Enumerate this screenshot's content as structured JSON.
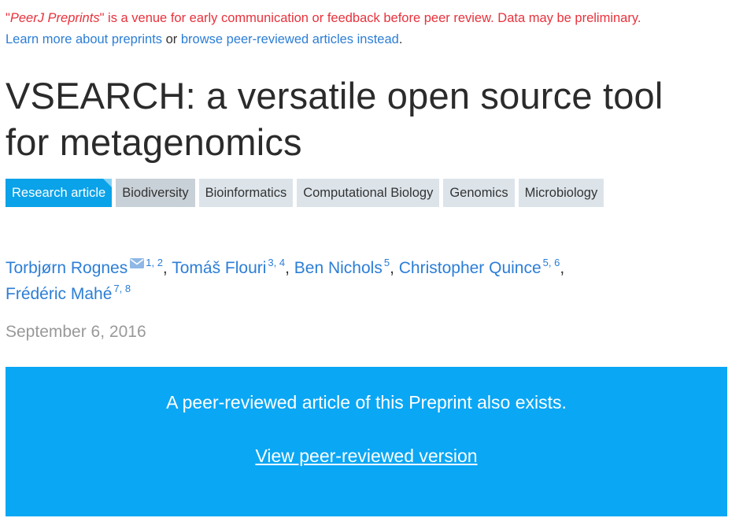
{
  "notice": {
    "quote_open": "\"",
    "venue": "PeerJ Preprints",
    "quote_close": "\"",
    "text": " is a venue for early communication or feedback before peer review. Data may be preliminary.",
    "learn_more_link": "Learn more about preprints",
    "or_text": " or ",
    "browse_link": "browse peer-reviewed articles instead",
    "period": "."
  },
  "article": {
    "title": "VSEARCH: a versatile open source tool for metagenomics",
    "type_tag": "Research article",
    "subject_tags": [
      "Biodiversity",
      "Bioinformatics",
      "Computational Biology",
      "Genomics",
      "Microbiology"
    ],
    "authors": [
      {
        "name": "Torbjørn Rognes",
        "affil": "1, 2",
        "has_email": true
      },
      {
        "name": "Tomáš Flouri",
        "affil": "3, 4",
        "has_email": false
      },
      {
        "name": "Ben Nichols",
        "affil": "5",
        "has_email": false
      },
      {
        "name": "Christopher Quince",
        "affil": "5, 6",
        "has_email": false
      },
      {
        "name": "Frédéric Mahé",
        "affil": "7, 8",
        "has_email": false
      }
    ],
    "separator": ", ",
    "date": "September 6, 2016"
  },
  "banner": {
    "message": "A peer-reviewed article of this Preprint also exists.",
    "link_label": "View peer-reviewed version"
  },
  "colors": {
    "notice_red": "#e8323c",
    "link_blue": "#2c7ed6",
    "type_tag_bg": "#0aa2e8",
    "subject_tag_bg": "#dce4ea",
    "banner_bg": "#0aa7f5",
    "date_gray": "#999999"
  },
  "icons": {
    "email": "envelope-icon"
  }
}
